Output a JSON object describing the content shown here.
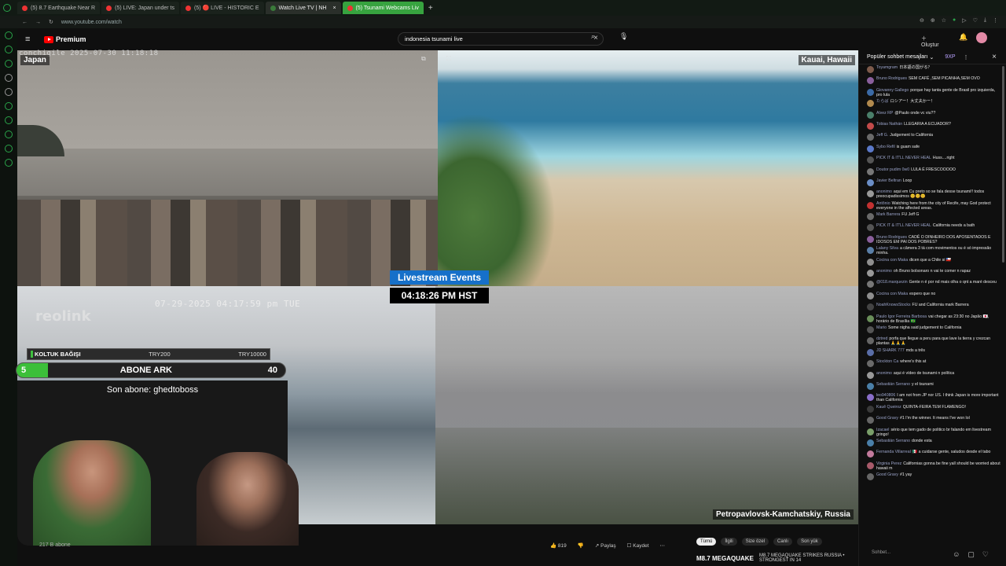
{
  "browser": {
    "tabs": [
      {
        "label": "(5) 8.7 Earthquake Near R",
        "state": "normal"
      },
      {
        "label": "(5) LIVE: Japan under ts",
        "state": "normal"
      },
      {
        "label": "(5) 🔴 LIVE - HISTORIC E",
        "state": "normal"
      },
      {
        "label": "Watch Live TV | NH",
        "state": "active"
      },
      {
        "label": "(5) Tsunami Webcams Liv",
        "state": "green"
      }
    ],
    "url": "www.youtube.com/watch",
    "new_tab": "+"
  },
  "youtube": {
    "logo_text": "Premium",
    "search_value": "indonesia tsunami live",
    "create_label": "Oluştur"
  },
  "video": {
    "cams": {
      "japan": "Japan",
      "kauai": "Kauai, Hawaii",
      "kamchatka": "Petropavlovsk-Kamchatskiy, Russia"
    },
    "japan_timestamp": "conchigile 2025-07-30 11:18:18",
    "reolink_timestamp": "07-29-2025 04:17:59 pm TUE",
    "reolink_logo": "reolink",
    "event_title": "Livestream Events",
    "event_time": "04:18:26 PM HST"
  },
  "overlay": {
    "donation_label": "KOLTUK BAĞIŞI",
    "donation_a": "TRY200",
    "donation_b": "TRY10000",
    "sub_level": "5",
    "sub_title": "ABONE ARK",
    "sub_count": "40",
    "last_sub": "Son abone: ghedtoboss"
  },
  "below_video": {
    "channel_subs": "217 B abone",
    "likes": "819",
    "share": "Paylaş",
    "save": "Kaydet",
    "chips": [
      "Tümü",
      "İlgili",
      "Size özel",
      "Canlı",
      "Son yük"
    ],
    "news_tag": "M8.7 MEGAQUAKE",
    "news_text": "M8.7 MEGAQUAKE STRIKES RUSSIA • STRONGEST IN 14"
  },
  "chat": {
    "title": "Popüler sohbet mesajları",
    "points": "9XP",
    "input_placeholder": "Sohbet...",
    "messages": [
      {
        "author": "Toyamgram",
        "text": "日本語の国がる？",
        "color": "#7d5a4b"
      },
      {
        "author": "Bruno Rodrigues",
        "text": "SEM CAFÉ ,SEM PICANHA,SEM OVO",
        "color": "#8a5f9c"
      },
      {
        "author": "Giovanny Gallego",
        "text": "porque hay tanta gente de Brasil pro izquierda, pro lula",
        "color": "#3b6aa6"
      },
      {
        "author": "たらば",
        "text": "ロシアー！大丈夫かー！",
        "color": "#b28a4e"
      },
      {
        "author": "Alvez RP",
        "text": "@Paulo onde vc viu??",
        "color": "#4a7f6a"
      },
      {
        "author": "Tobias Nathán",
        "text": "LLEGARIA A ECUADOR?",
        "color": "#c24a4a"
      },
      {
        "author": "Jeff G.",
        "text": "Judgement to California",
        "color": "#6a6a6a"
      },
      {
        "author": "Sybo Refil",
        "text": "is guam safe",
        "color": "#5b79c9"
      },
      {
        "author": "PICK IT & IT'LL NEVER HEAL",
        "text": "Huss....right",
        "color": "#555"
      },
      {
        "author": "Doutor pudim 0w0",
        "text": "LULA É FRESCOOOOO",
        "color": "#777"
      },
      {
        "author": "Javier Beltran",
        "text": "Loop",
        "color": "#6b8ec6"
      },
      {
        "author": "anonimo",
        "text": "aqui em Cu preto so se fala desse tsunami!! todos preocupadissimos 😊😊😊",
        "color": "#999"
      },
      {
        "author": "Antônio",
        "text": "Watching here from the city of Recife, may God protect everyone in the affected areas.",
        "color": "#c23131"
      },
      {
        "author": "Mark Barrera",
        "text": "FU Jeff G",
        "color": "#6a6a6a"
      },
      {
        "author": "PICK IT & IT'LL NEVER HEAL",
        "text": "California needs a bath",
        "color": "#555"
      },
      {
        "author": "Bruno Rodrigues",
        "text": "CADÊ O DINHEIRO DOS APOSENTADOS E IDOSOS EM PAI DOS POBRES?",
        "color": "#8a5f9c"
      },
      {
        "author": "Lalany Silva",
        "text": "a câmera 3 tá com movimentos ou é só impressão minha.",
        "color": "#5a7fa8"
      },
      {
        "author": "Cocina con Maka",
        "text": "dicen que a Chile si 🇨🇱",
        "color": "#8f8f8f"
      },
      {
        "author": "anonimo",
        "text": "oh Bruno bolsonaro n vai te comer n rapaz",
        "color": "#999"
      },
      {
        "author": "@018.marquezin",
        "text": "Gente n é por nd mais olha o qnt a maré desceu",
        "color": "#777"
      },
      {
        "author": "Cocina con Maka",
        "text": "espero que no",
        "color": "#8f8f8f"
      },
      {
        "author": "NoahKnowsStocks",
        "text": "FU and California mark Barrera",
        "color": "#444"
      },
      {
        "author": "Paulo Igor Ferreira Barbosa",
        "text": "vai chegar as 23:30 no Japão 🇯🇵, horário de Brasília 🇧🇷",
        "color": "#6a8f5a"
      },
      {
        "author": "Mario",
        "text": "Some nigha said judgement to California",
        "color": "#555"
      },
      {
        "author": "dztred",
        "text": "porfa que llegue a peru para que lave la tierra y crezcan plantas 🙏🙏🙏",
        "color": "#666"
      },
      {
        "author": "JD SHARK 777",
        "text": "mds a três",
        "color": "#5a6ea8"
      },
      {
        "author": "Stockton Ca",
        "text": "where's this at",
        "color": "#6a6a6a"
      },
      {
        "author": "anonimo",
        "text": "aqui é vídeo de tsunami n política",
        "color": "#999"
      },
      {
        "author": "Sebastián Serrano",
        "text": "y el tsunami",
        "color": "#4a7fa8"
      },
      {
        "author": "leo940806",
        "text": "I am not from JP nor US. I think Japan is more important than California",
        "color": "#8a6ec9"
      },
      {
        "author": "Kauê Queiroz",
        "text": "QUINTA-FEIRA TEM FLAMENGO!",
        "color": "#3a3a3a"
      },
      {
        "author": "Good Gravy",
        "text": "#1 I'm the winner. It means I've won lol",
        "color": "#666"
      },
      {
        "author": "Izacael",
        "text": "sério que tem gado de politico br falando em livestream gringo!",
        "color": "#7a9f6a"
      },
      {
        "author": "Sebastián Serrano",
        "text": "donde esta",
        "color": "#4a7fa8"
      },
      {
        "author": "Fernanda Villarreal",
        "text": "🇲🇽 a cuidarse gente, saludos desde el tabo",
        "color": "#c27a9c"
      },
      {
        "author": "Virginia Perez",
        "text": "Californias gonna be fine yall should be worried about hawaii m",
        "color": "#a85a6a"
      },
      {
        "author": "Good Gravy",
        "text": "#1 yay",
        "color": "#666"
      }
    ]
  }
}
